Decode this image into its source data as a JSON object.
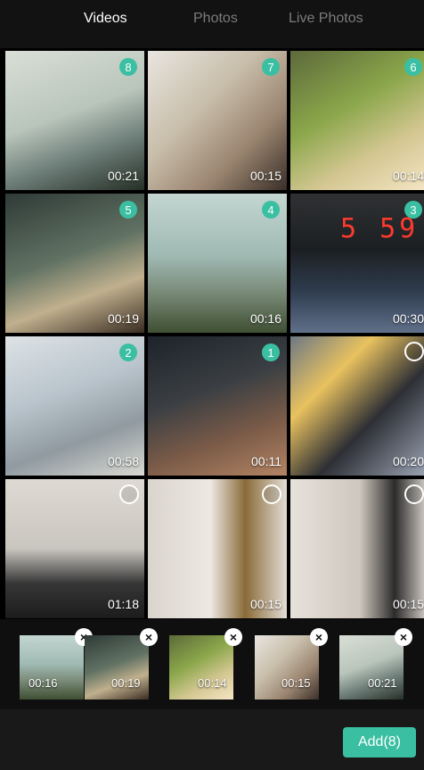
{
  "tabs": [
    "Videos",
    "Photos",
    "Live Photos"
  ],
  "active_tab": "Videos",
  "grid": [
    {
      "duration": "00:21",
      "badge": "8",
      "selected": true
    },
    {
      "duration": "00:15",
      "badge": "7",
      "selected": true
    },
    {
      "duration": "00:14",
      "badge": "6",
      "selected": true
    },
    {
      "duration": "00:19",
      "badge": "5",
      "selected": true
    },
    {
      "duration": "00:16",
      "badge": "4",
      "selected": true
    },
    {
      "duration": "00:30",
      "badge": "3",
      "selected": true
    },
    {
      "duration": "00:58",
      "badge": "2",
      "selected": true
    },
    {
      "duration": "00:11",
      "badge": "1",
      "selected": true
    },
    {
      "duration": "00:20",
      "badge": "",
      "selected": false
    },
    {
      "duration": "01:18",
      "badge": "",
      "selected": false
    },
    {
      "duration": "00:15",
      "badge": "",
      "selected": false
    },
    {
      "duration": "00:15",
      "badge": "",
      "selected": false
    }
  ],
  "clock_display": "5 59",
  "selected_tray": [
    {
      "duration": "00:16"
    },
    {
      "duration": "00:19"
    },
    {
      "duration": "00:14"
    },
    {
      "duration": "00:15"
    },
    {
      "duration": "00:21"
    }
  ],
  "close_glyph": "×",
  "add_button_label": "Add(8)",
  "colors": {
    "accent": "#3bbfa2",
    "background": "#000000"
  }
}
